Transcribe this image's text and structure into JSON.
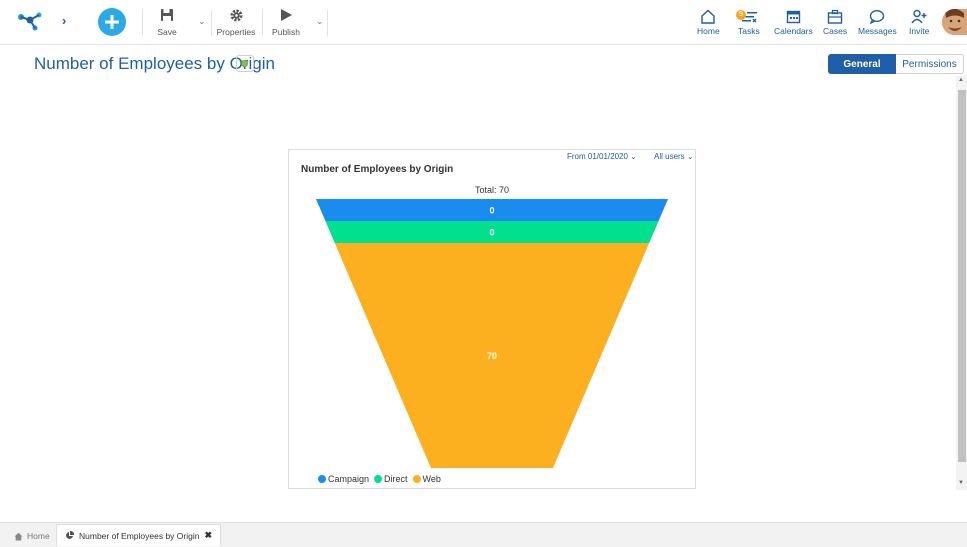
{
  "toolbar": {
    "save_label": "Save",
    "properties_label": "Properties",
    "publish_label": "Publish",
    "nav": {
      "home": "Home",
      "tasks": "Tasks",
      "tasks_badge": "9",
      "calendars": "Calendars",
      "cases": "Cases",
      "messages": "Messages",
      "invite": "Invite"
    },
    "accent_color": "#2aa8e8"
  },
  "page": {
    "title": "Number of Employees by Origin",
    "status_color": "#8bc34a",
    "tabs": [
      {
        "label": "General",
        "active": true
      },
      {
        "label": "Permissions",
        "active": false
      }
    ]
  },
  "widget": {
    "filter_date": "From 01/01/2020 ⌄",
    "filter_users": "All users ⌄",
    "title": "Number of Employees by Origin",
    "total_label": "Total: 70"
  },
  "chart_data": {
    "type": "funnel",
    "title": "Number of Employees by Origin",
    "total": 70,
    "categories": [
      "Campaign",
      "Direct",
      "Web"
    ],
    "values": [
      0,
      0,
      70
    ],
    "colors": [
      "#1a8cf0",
      "#00e08f",
      "#fdb01f"
    ],
    "legend_position": "bottom-left"
  },
  "bottom_tabs": {
    "home": "Home",
    "active": "Number of Employees by Origin"
  }
}
